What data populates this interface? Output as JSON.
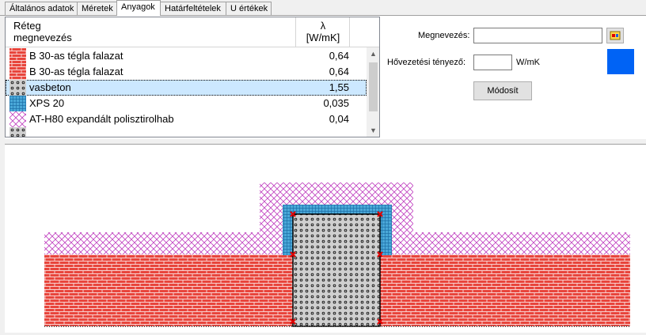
{
  "tabs": [
    {
      "label": "Általános adatok",
      "active": false
    },
    {
      "label": "Méretek",
      "active": false
    },
    {
      "label": "Anyagok",
      "active": true
    },
    {
      "label": "Határfeltételek",
      "active": false
    },
    {
      "label": "U értékek",
      "active": false
    }
  ],
  "materials_table": {
    "col_name_line1": "Réteg",
    "col_name_line2": "megnevezés",
    "col_lambda_line1": "λ",
    "col_lambda_line2": "[W/mK]",
    "rows": [
      {
        "name": "B 30-as tégla falazat",
        "value": "0,64",
        "pattern": "brick",
        "selected": false
      },
      {
        "name": "B 30-as tégla falazat",
        "value": "0,64",
        "pattern": "brick",
        "selected": false
      },
      {
        "name": "vasbeton",
        "value": "1,55",
        "pattern": "concrete",
        "selected": true
      },
      {
        "name": "XPS 20",
        "value": "0,035",
        "pattern": "xps",
        "selected": false
      },
      {
        "name": "AT-H80 expandált polisztirolhab",
        "value": "0,04",
        "pattern": "eps",
        "selected": false
      },
      {
        "name": "",
        "value": "",
        "pattern": "partial",
        "selected": false
      }
    ]
  },
  "form": {
    "name_label": "Megnevezés:",
    "name_value": "",
    "conductivity_label": "Hővezetési tényező:",
    "conductivity_value": "",
    "conductivity_unit": "W/mK",
    "modify_button": "Módosít",
    "selected_color": "#0063f5"
  },
  "icons": {
    "color_picker": "color-picker-icon",
    "scroll_up": "scroll-up-arrow-icon",
    "scroll_down": "scroll-down-arrow-icon"
  },
  "colors": {
    "brick": "#e8453c",
    "eps": "#c040c0",
    "xps": "#4aa8d8",
    "marker": "#e00000"
  }
}
